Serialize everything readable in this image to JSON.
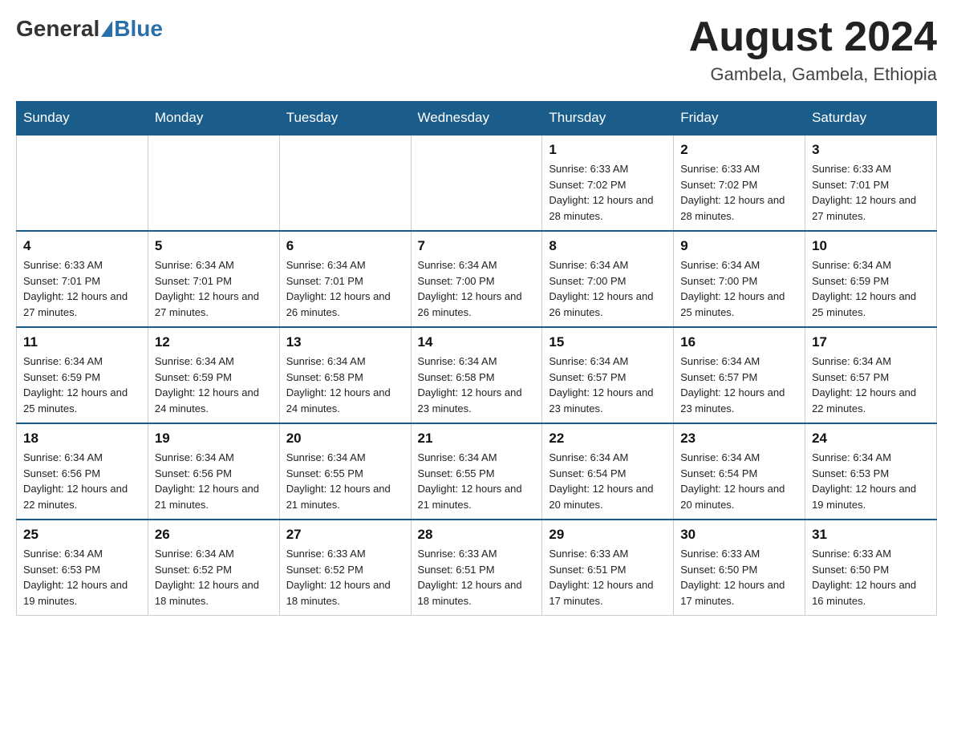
{
  "header": {
    "logo_general": "General",
    "logo_blue": "Blue",
    "month_title": "August 2024",
    "location": "Gambela, Gambela, Ethiopia"
  },
  "days_of_week": [
    "Sunday",
    "Monday",
    "Tuesday",
    "Wednesday",
    "Thursday",
    "Friday",
    "Saturday"
  ],
  "weeks": [
    [
      {
        "day": "",
        "info": ""
      },
      {
        "day": "",
        "info": ""
      },
      {
        "day": "",
        "info": ""
      },
      {
        "day": "",
        "info": ""
      },
      {
        "day": "1",
        "info": "Sunrise: 6:33 AM\nSunset: 7:02 PM\nDaylight: 12 hours and 28 minutes."
      },
      {
        "day": "2",
        "info": "Sunrise: 6:33 AM\nSunset: 7:02 PM\nDaylight: 12 hours and 28 minutes."
      },
      {
        "day": "3",
        "info": "Sunrise: 6:33 AM\nSunset: 7:01 PM\nDaylight: 12 hours and 27 minutes."
      }
    ],
    [
      {
        "day": "4",
        "info": "Sunrise: 6:33 AM\nSunset: 7:01 PM\nDaylight: 12 hours and 27 minutes."
      },
      {
        "day": "5",
        "info": "Sunrise: 6:34 AM\nSunset: 7:01 PM\nDaylight: 12 hours and 27 minutes."
      },
      {
        "day": "6",
        "info": "Sunrise: 6:34 AM\nSunset: 7:01 PM\nDaylight: 12 hours and 26 minutes."
      },
      {
        "day": "7",
        "info": "Sunrise: 6:34 AM\nSunset: 7:00 PM\nDaylight: 12 hours and 26 minutes."
      },
      {
        "day": "8",
        "info": "Sunrise: 6:34 AM\nSunset: 7:00 PM\nDaylight: 12 hours and 26 minutes."
      },
      {
        "day": "9",
        "info": "Sunrise: 6:34 AM\nSunset: 7:00 PM\nDaylight: 12 hours and 25 minutes."
      },
      {
        "day": "10",
        "info": "Sunrise: 6:34 AM\nSunset: 6:59 PM\nDaylight: 12 hours and 25 minutes."
      }
    ],
    [
      {
        "day": "11",
        "info": "Sunrise: 6:34 AM\nSunset: 6:59 PM\nDaylight: 12 hours and 25 minutes."
      },
      {
        "day": "12",
        "info": "Sunrise: 6:34 AM\nSunset: 6:59 PM\nDaylight: 12 hours and 24 minutes."
      },
      {
        "day": "13",
        "info": "Sunrise: 6:34 AM\nSunset: 6:58 PM\nDaylight: 12 hours and 24 minutes."
      },
      {
        "day": "14",
        "info": "Sunrise: 6:34 AM\nSunset: 6:58 PM\nDaylight: 12 hours and 23 minutes."
      },
      {
        "day": "15",
        "info": "Sunrise: 6:34 AM\nSunset: 6:57 PM\nDaylight: 12 hours and 23 minutes."
      },
      {
        "day": "16",
        "info": "Sunrise: 6:34 AM\nSunset: 6:57 PM\nDaylight: 12 hours and 23 minutes."
      },
      {
        "day": "17",
        "info": "Sunrise: 6:34 AM\nSunset: 6:57 PM\nDaylight: 12 hours and 22 minutes."
      }
    ],
    [
      {
        "day": "18",
        "info": "Sunrise: 6:34 AM\nSunset: 6:56 PM\nDaylight: 12 hours and 22 minutes."
      },
      {
        "day": "19",
        "info": "Sunrise: 6:34 AM\nSunset: 6:56 PM\nDaylight: 12 hours and 21 minutes."
      },
      {
        "day": "20",
        "info": "Sunrise: 6:34 AM\nSunset: 6:55 PM\nDaylight: 12 hours and 21 minutes."
      },
      {
        "day": "21",
        "info": "Sunrise: 6:34 AM\nSunset: 6:55 PM\nDaylight: 12 hours and 21 minutes."
      },
      {
        "day": "22",
        "info": "Sunrise: 6:34 AM\nSunset: 6:54 PM\nDaylight: 12 hours and 20 minutes."
      },
      {
        "day": "23",
        "info": "Sunrise: 6:34 AM\nSunset: 6:54 PM\nDaylight: 12 hours and 20 minutes."
      },
      {
        "day": "24",
        "info": "Sunrise: 6:34 AM\nSunset: 6:53 PM\nDaylight: 12 hours and 19 minutes."
      }
    ],
    [
      {
        "day": "25",
        "info": "Sunrise: 6:34 AM\nSunset: 6:53 PM\nDaylight: 12 hours and 19 minutes."
      },
      {
        "day": "26",
        "info": "Sunrise: 6:34 AM\nSunset: 6:52 PM\nDaylight: 12 hours and 18 minutes."
      },
      {
        "day": "27",
        "info": "Sunrise: 6:33 AM\nSunset: 6:52 PM\nDaylight: 12 hours and 18 minutes."
      },
      {
        "day": "28",
        "info": "Sunrise: 6:33 AM\nSunset: 6:51 PM\nDaylight: 12 hours and 18 minutes."
      },
      {
        "day": "29",
        "info": "Sunrise: 6:33 AM\nSunset: 6:51 PM\nDaylight: 12 hours and 17 minutes."
      },
      {
        "day": "30",
        "info": "Sunrise: 6:33 AM\nSunset: 6:50 PM\nDaylight: 12 hours and 17 minutes."
      },
      {
        "day": "31",
        "info": "Sunrise: 6:33 AM\nSunset: 6:50 PM\nDaylight: 12 hours and 16 minutes."
      }
    ]
  ]
}
